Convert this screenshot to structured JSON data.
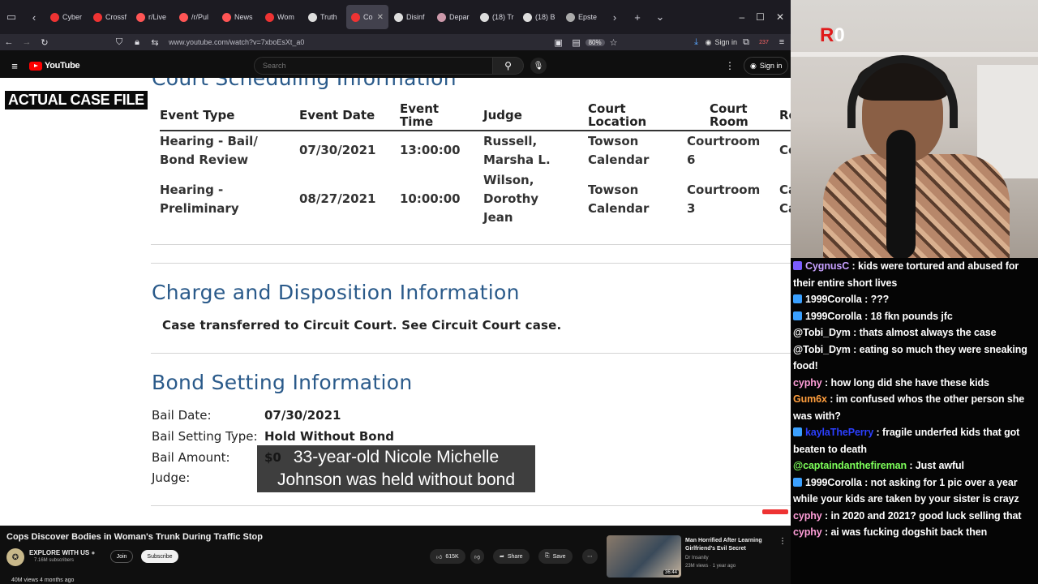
{
  "browser": {
    "tabs": [
      {
        "label": "Cyber",
        "color": "#e33"
      },
      {
        "label": "Crossf",
        "color": "#e33"
      },
      {
        "label": "r/Live",
        "color": "#f55"
      },
      {
        "label": "/r/Pul",
        "color": "#f55"
      },
      {
        "label": "News",
        "color": "#f55"
      },
      {
        "label": "Wom",
        "color": "#e33"
      },
      {
        "label": "Truth",
        "color": "#ddd"
      },
      {
        "label": "Co",
        "color": "#e33"
      },
      {
        "label": "Disinf",
        "color": "#ddd"
      },
      {
        "label": "Depar",
        "color": "#c9a"
      },
      {
        "label": "(18) Tr",
        "color": "#ddd"
      },
      {
        "label": "(18) B",
        "color": "#ddd"
      },
      {
        "label": "Epste",
        "color": "#aaa"
      }
    ],
    "url": "www.youtube.com/watch?v=7xboEsXt_a0",
    "zoom": "80%",
    "signin": "Sign in",
    "badge_count": "237"
  },
  "youtube": {
    "logo": "YouTube",
    "search_placeholder": "Search",
    "signin": "Sign in"
  },
  "video": {
    "overlay_label": "ACTUAL CASE FILE",
    "scheduling_heading": "Court Scheduling Information",
    "table_headers": [
      "Event Type",
      "Event Date",
      "Event Time",
      "Judge",
      "Court Location",
      "Court Room",
      "Re"
    ],
    "rows": [
      {
        "type": "Hearing - Bail/ Bond Review",
        "date": "07/30/2021",
        "time": "13:00:00",
        "judge": "Russell, Marsha L.",
        "location": "Towson Calendar",
        "room": "Courtroom 6",
        "result": "Co"
      },
      {
        "type": "Hearing - Preliminary",
        "date": "08/27/2021",
        "time": "10:00:00",
        "judge": "Wilson, Dorothy Jean",
        "location": "Towson Calendar",
        "room": "Courtroom 3",
        "result": "Ca Ca"
      }
    ],
    "charge_heading": "Charge and Disposition Information",
    "charge_text": "Case transferred to Circuit Court. See Circuit Court case.",
    "bond_heading": "Bond Setting Information",
    "bond": {
      "bail_date_label": "Bail Date:",
      "bail_date": "07/30/2021",
      "type_label": "Bail Setting Type:",
      "type": "Hold Without Bond",
      "amount_label": "Bail Amount:",
      "amount": "$0",
      "judge_label": "Judge:"
    },
    "caption_line1": "33-year-old Nicole Michelle",
    "caption_line2": "Johnson was held without bond"
  },
  "below_video": {
    "title": "Cops Discover Bodies in Woman's Trunk During Traffic Stop",
    "channel": "EXPLORE WITH US",
    "subscribers": "7.16M subscribers",
    "join": "Join",
    "subscribe": "Subscribe",
    "likes": "615K",
    "share": "Share",
    "save": "Save",
    "views": "40M views  4 months ago",
    "rec": {
      "title": "Man Horrified After Learning Girlfriend's Evil Secret",
      "channel": "Dr Insanity",
      "meta": "23M views · 1 year ago",
      "duration": "36:44"
    }
  },
  "webcam": {
    "logo": "0"
  },
  "chat": [
    {
      "user": "CygnusC",
      "color": "#c7a0ff",
      "badge": "#7a5cff",
      "text": "kids were tortured and abused for their entire short lives"
    },
    {
      "user": "1999Corolla",
      "color": "#ffffff",
      "badge": "#3aa0ff",
      "text": "???"
    },
    {
      "user": "1999Corolla",
      "color": "#ffffff",
      "badge": "#3aa0ff",
      "text": "18 fkn pounds jfc"
    },
    {
      "user": "@Tobi_Dym",
      "color": "#ffffff",
      "badge": "",
      "text": "thats almost always the case"
    },
    {
      "user": "@Tobi_Dym",
      "color": "#ffffff",
      "badge": "",
      "text": "eating so much they were sneaking food!"
    },
    {
      "user": "cyphy",
      "color": "#ff9ed8",
      "badge": "",
      "text": "how long did she have these kids"
    },
    {
      "user": "Gum6x",
      "color": "#ff9e3d",
      "badge": "",
      "text": "im confused whos the other person she was with?"
    },
    {
      "user": "kaylaThePerry",
      "color": "#2b3fff",
      "badge": "#3aa0ff",
      "text": "fragile underfed kids that got beaten to death"
    },
    {
      "user": "@captaindanthefireman",
      "color": "#7dff5a",
      "badge": "",
      "text": "Just awful"
    },
    {
      "user": "1999Corolla",
      "color": "#ffffff",
      "badge": "#3aa0ff",
      "text": "not asking for 1 pic over a year while your kids are taken by your sister is crayz"
    },
    {
      "user": "cyphy",
      "color": "#ff9ed8",
      "badge": "",
      "text": "in 2020 and 2021? good luck selling that"
    },
    {
      "user": "cyphy",
      "color": "#ff9ed8",
      "badge": "",
      "text": "ai was fucking dogshit back then"
    }
  ]
}
